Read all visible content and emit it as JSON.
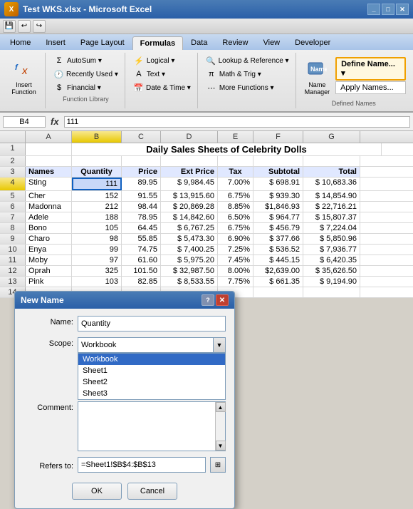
{
  "titlebar": {
    "title": "Test WKS.xlsx - Microsoft Excel",
    "logo": "X"
  },
  "ribbon_tabs": [
    "Home",
    "Insert",
    "Page Layout",
    "Formulas",
    "Data",
    "Review",
    "View",
    "Developer"
  ],
  "active_tab": "Formulas",
  "ribbon": {
    "groups": [
      {
        "label": "Insert Function",
        "type": "large",
        "icon": "fx"
      },
      {
        "label": "Function Library",
        "items": [
          {
            "icon": "Σ",
            "label": "AutoSum ▾"
          },
          {
            "icon": "🕐",
            "label": "Recently Used ▾"
          },
          {
            "icon": "$",
            "label": "Financial ▾"
          }
        ]
      },
      {
        "label": "",
        "items": [
          {
            "icon": "?",
            "label": "Logical ▾"
          },
          {
            "icon": "A",
            "label": "Text ▾"
          },
          {
            "icon": "📅",
            "label": "Date & Time ▾"
          }
        ]
      },
      {
        "label": "",
        "items": [
          {
            "icon": "🔍",
            "label": "Lookup & Reference ▾"
          },
          {
            "icon": "π",
            "label": "Math & Trig ▾"
          },
          {
            "icon": "⋯",
            "label": "More Functions ▾"
          }
        ]
      },
      {
        "label": "Defined Names",
        "special": true,
        "items": [
          {
            "label": "Define Name...",
            "highlighted": true
          },
          {
            "label": "Apply Names..."
          }
        ],
        "name_manager": "Name\nManager"
      }
    ]
  },
  "formula_bar": {
    "cell_ref": "B4",
    "fx": "fx",
    "value": "111"
  },
  "spreadsheet": {
    "columns": [
      "A",
      "B",
      "C",
      "D",
      "E",
      "F",
      "G"
    ],
    "selected_col": "B",
    "title_row": {
      "row_num": "1",
      "title": "Daily Sales Sheets of Celebrity Dolls",
      "span": 7
    },
    "headers_row": {
      "row_num": "3",
      "cells": [
        "Names",
        "Quantity",
        "Price",
        "Ext Price",
        "Tax",
        "Subtotal",
        "Total"
      ]
    },
    "data_rows": [
      {
        "row": "4",
        "cells": [
          "Sting",
          "111",
          "89.95",
          "$ 9,984.45",
          "7.00%",
          "$ 698.91",
          "$ 10,683.36"
        ],
        "selected": true
      },
      {
        "row": "5",
        "cells": [
          "Cher",
          "152",
          "91.55",
          "$ 13,915.60",
          "6.75%",
          "$ 939.30",
          "$ 14,854.90"
        ]
      },
      {
        "row": "6",
        "cells": [
          "Madonna",
          "212",
          "98.44",
          "$ 20,869.28",
          "8.85%",
          "$1,846.93",
          "$ 22,716.21"
        ]
      },
      {
        "row": "7",
        "cells": [
          "Adele",
          "188",
          "78.95",
          "$ 14,842.60",
          "6.50%",
          "$ 964.77",
          "$ 15,807.37"
        ]
      },
      {
        "row": "8",
        "cells": [
          "Bono",
          "105",
          "64.45",
          "$ 6,767.25",
          "6.75%",
          "$ 456.79",
          "$ 7,224.04"
        ]
      },
      {
        "row": "9",
        "cells": [
          "Charo",
          "98",
          "55.85",
          "$ 5,473.30",
          "6.90%",
          "$ 377.66",
          "$ 5,850.96"
        ]
      },
      {
        "row": "10",
        "cells": [
          "Enya",
          "99",
          "74.75",
          "$ 7,400.25",
          "7.25%",
          "$ 536.52",
          "$ 7,936.77"
        ]
      },
      {
        "row": "11",
        "cells": [
          "Moby",
          "97",
          "61.60",
          "$ 5,975.20",
          "7.45%",
          "$ 445.15",
          "$ 6,420.35"
        ]
      },
      {
        "row": "12",
        "cells": [
          "Oprah",
          "325",
          "101.50",
          "$ 32,987.50",
          "8.00%",
          "$2,639.00",
          "$ 35,626.50"
        ]
      },
      {
        "row": "13",
        "cells": [
          "Pink",
          "103",
          "82.85",
          "$ 8,533.55",
          "7.75%",
          "$ 661.35",
          "$ 9,194.90"
        ]
      }
    ],
    "empty_rows": [
      "2",
      "14"
    ]
  },
  "dialog": {
    "title": "New Name",
    "name_label": "Name:",
    "name_value": "Quantity",
    "scope_label": "Scope:",
    "scope_value": "Workbook",
    "scope_options": [
      "Workbook",
      "Sheet1",
      "Sheet2",
      "Sheet3"
    ],
    "comment_label": "Comment:",
    "refers_label": "Refers to:",
    "refers_value": "=Sheet1!$B$4:$B$13",
    "ok_label": "OK",
    "cancel_label": "Cancel"
  },
  "dropdown_menu": {
    "items": [
      "Define Name...",
      "Apply Names..."
    ]
  }
}
